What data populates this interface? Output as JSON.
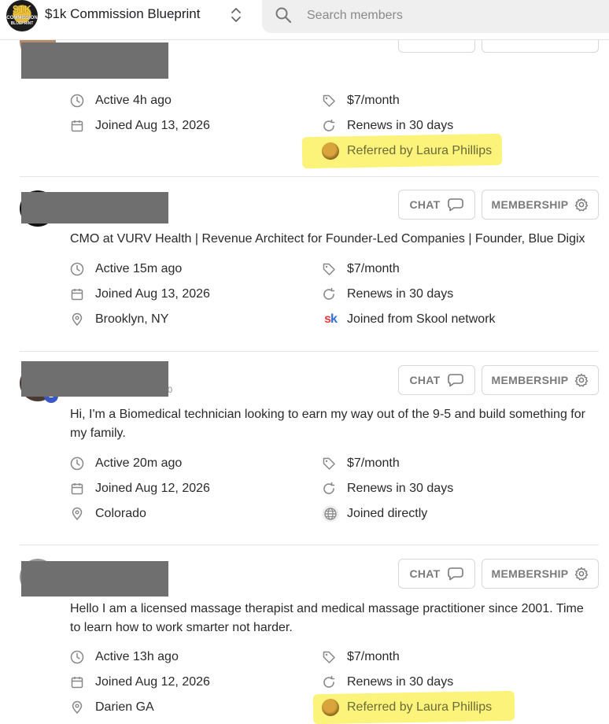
{
  "header": {
    "logo_lines": [
      "$1K",
      "COMMISSION",
      "BLUEPRINT"
    ],
    "group_name": "$1k Commission Blueprint",
    "search_placeholder": "Search members"
  },
  "buttons": {
    "chat": "CHAT",
    "membership": "MEMBERSHIP"
  },
  "members": [
    {
      "active": "Active 4h ago",
      "joined": "Joined Aug 13, 2026",
      "price": "$7/month",
      "renews": "Renews in 30 days",
      "source": "Referred by Laura Phillips",
      "source_type": "referral"
    },
    {
      "bio": "CMO at VURV Health | Revenue Architect for Founder-Led Companies | Founder, Blue Digix",
      "active": "Active 15m ago",
      "joined": "Joined Aug 13, 2026",
      "location": "Brooklyn, NY",
      "price": "$7/month",
      "renews": "Renews in 30 days",
      "source": "Joined from Skool network",
      "source_type": "skool"
    },
    {
      "badge": "2",
      "name_fragment": "0",
      "bio": "Hi, I'm a Biomedical technician looking to earn my way out of the 9-5 and build something for my family.",
      "active": "Active 20m ago",
      "joined": "Joined Aug 12, 2026",
      "location": "Colorado",
      "price": "$7/month",
      "renews": "Renews in 30 days",
      "source": "Joined directly",
      "source_type": "direct"
    },
    {
      "bio": "Hello I am a licensed massage therapist and medical massage practitioner since 2001. Time to learn how to work smarter not harder.",
      "active": "Active 13h ago",
      "joined": "Joined Aug 12, 2026",
      "location": "Darien GA",
      "price": "$7/month",
      "renews": "Renews in 30 days",
      "source": "Referred by Laura Phillips",
      "source_type": "referral"
    }
  ],
  "colors": {
    "highlight": "#fbf37a",
    "redaction": "#6f6f6f",
    "skool_red": "#e63b3b",
    "skool_blue": "#2d6ee0"
  }
}
